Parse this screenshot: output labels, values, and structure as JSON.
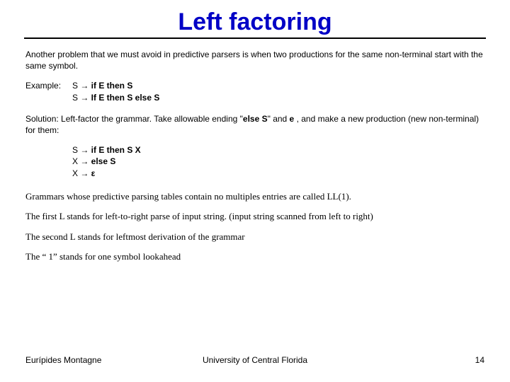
{
  "title": "Left factoring",
  "p1": "Another problem that we must avoid in predictive parsers is when two productions for the same non-terminal start with the same symbol.",
  "example_label": "Example:",
  "ex_line1_pre": "S → ",
  "ex_line1_bold": "if E then S",
  "ex_line2_pre": "S → ",
  "ex_line2_bold": "If E then S else S",
  "sol_a": "Solution: Left-factor the grammar. Take allowable ending \"",
  "sol_b": "else S",
  "sol_c": "\" and ",
  "sol_d": "e",
  "sol_e": " , and make a new production (new non-terminal) for them:",
  "prod2_l1_pre": "S → ",
  "prod2_l1_bold": "if E then S X",
  "prod2_l2_pre": "X → ",
  "prod2_l2_bold": "else S",
  "prod2_l3_pre": "X → ",
  "prod2_l3_bold": "ε",
  "serif1": "Grammars whose predictive parsing tables contain no multiples entries are called LL(1).",
  "serif2": "The first L stands for left-to-right parse of input string. (input string scanned from left to right)",
  "serif3": "The second L stands for leftmost derivation of the grammar",
  "serif4": "The “ 1” stands for one symbol lookahead",
  "footer_left": "Eurípides Montagne",
  "footer_center": "University of Central Florida",
  "footer_right": "14"
}
